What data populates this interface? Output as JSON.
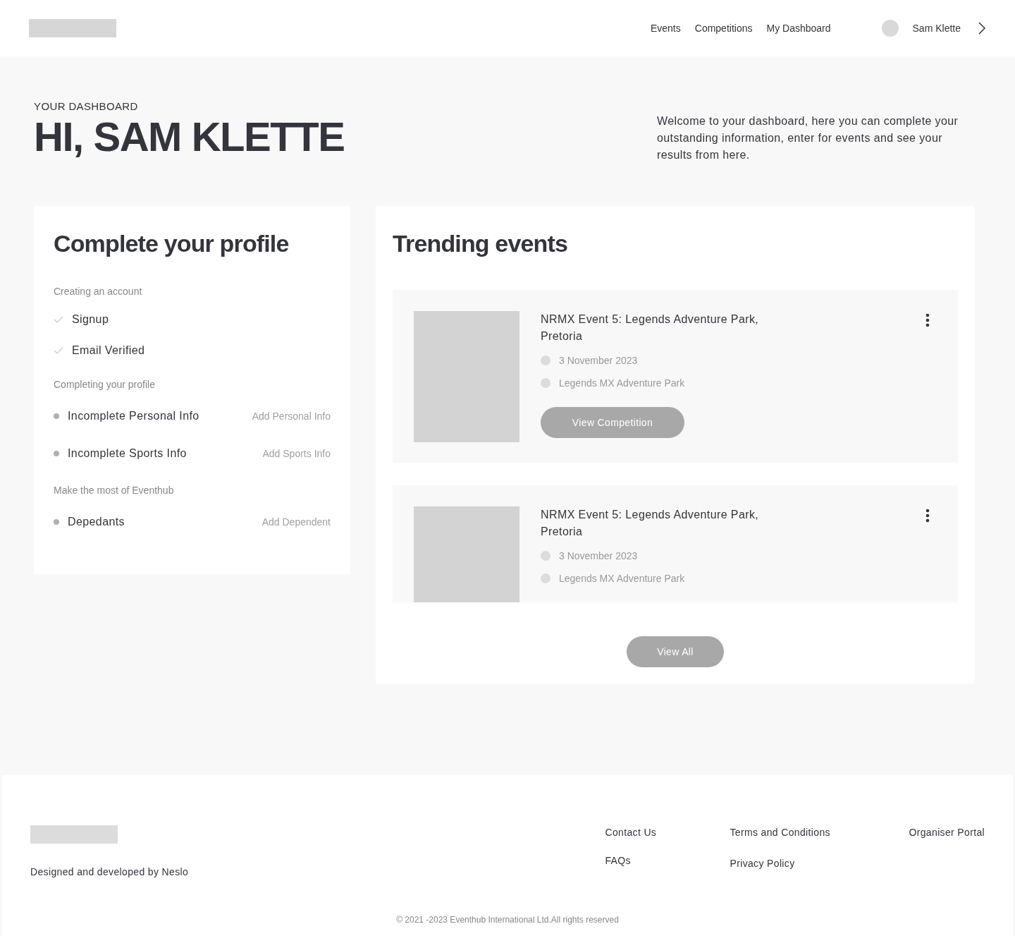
{
  "nav": {
    "links": [
      "Events",
      "Competitions",
      "My Dashboard"
    ],
    "user": "Sam Klette"
  },
  "hero": {
    "eyebrow": "YOUR DASHBOARD",
    "title": "HI, SAM KLETTE",
    "intro": "Welcome to your dashboard, here you can complete your outstanding information, enter for events and see your results from here."
  },
  "profile": {
    "title": "Complete your profile",
    "sections": [
      {
        "heading": "Creating an account",
        "items": [
          {
            "kind": "done",
            "label": "Signup"
          },
          {
            "kind": "done",
            "label": "Email Verified"
          }
        ]
      },
      {
        "heading": "Completing your profile",
        "items": [
          {
            "kind": "todo",
            "label": "Incomplete Personal Info",
            "action": "Add Personal Info"
          },
          {
            "kind": "todo",
            "label": "Incomplete Sports Info",
            "action": "Add Sports Info"
          }
        ]
      },
      {
        "heading": "Make the most of Eventhub",
        "items": [
          {
            "kind": "todo",
            "label": "Depedants",
            "action": "Add Dependent"
          }
        ]
      }
    ]
  },
  "trending": {
    "title": "Trending events",
    "events": [
      {
        "title": "NRMX Event 5: Legends Adventure Park, Pretoria",
        "date": "3 November 2023",
        "venue": "Legends MX Adventure Park",
        "button": "View Competition"
      },
      {
        "title": "NRMX Event 5: Legends Adventure Park, Pretoria",
        "date": "3 November 2023",
        "venue": "Legends MX Adventure Park"
      }
    ],
    "view_all": "View All"
  },
  "footer": {
    "credit": "Designed and developed by Neslo",
    "columns": [
      [
        "Contact Us",
        "FAQs"
      ],
      [
        "Terms and Conditions",
        "Privacy Policy"
      ],
      [
        "Organiser Portal"
      ]
    ],
    "copyright": "© 2021 -2023 Eventhub International Ltd.All rights reserved"
  }
}
